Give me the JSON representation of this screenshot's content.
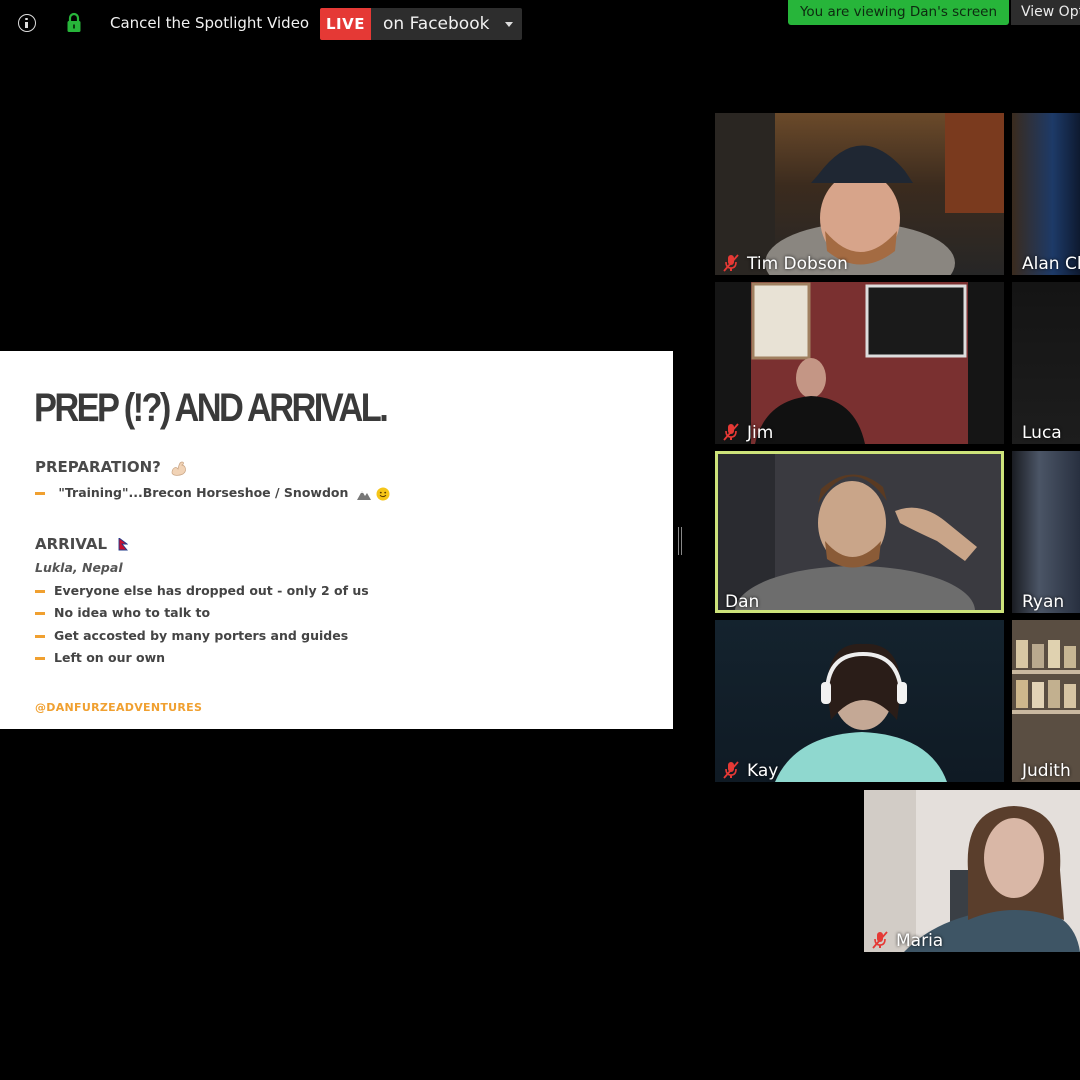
{
  "topbar": {
    "spotlight_label": "Cancel the Spotlight Video",
    "live_label": "LIVE",
    "live_destination": "on Facebook",
    "viewing_notice": "You are viewing Dan's screen",
    "view_options_label": "View Opt"
  },
  "slide": {
    "title": "PREP (!?) AND ARRIVAL.",
    "preparation_heading": "PREPARATION?",
    "preparation_items": [
      "\"Training\"...Brecon Horseshoe / Snowdon"
    ],
    "arrival_heading": "ARRIVAL",
    "arrival_location": "Lukla, Nepal",
    "arrival_items": [
      "Everyone else has dropped out - only 2 of us",
      "No idea who to talk to",
      "Get accosted by many porters and guides",
      "Left on our own"
    ],
    "footer": "@DANFURZEADVENTURES"
  },
  "participants": [
    {
      "name": "Tim Dobson",
      "muted": true
    },
    {
      "name": "Alan Cla",
      "muted": false
    },
    {
      "name": "Jim",
      "muted": true
    },
    {
      "name": "Luca",
      "muted": false
    },
    {
      "name": "Dan",
      "muted": false,
      "active_speaker": true
    },
    {
      "name": "Ryan",
      "muted": false
    },
    {
      "name": "Kay",
      "muted": true
    },
    {
      "name": "Judith",
      "muted": false
    },
    {
      "name": "Maria",
      "muted": true
    }
  ],
  "colors": {
    "live_red": "#e53935",
    "viewing_green": "#27b53a",
    "speaker_highlight": "#cde37a",
    "slide_accent": "#f0a030",
    "mute_red": "#e53935"
  },
  "icons": [
    "info-icon",
    "lock-icon",
    "chevron-down-icon",
    "mic-off-icon",
    "flexed-arm-emoji",
    "mountain-emoji",
    "smiley-emoji",
    "nepal-flag-emoji"
  ]
}
